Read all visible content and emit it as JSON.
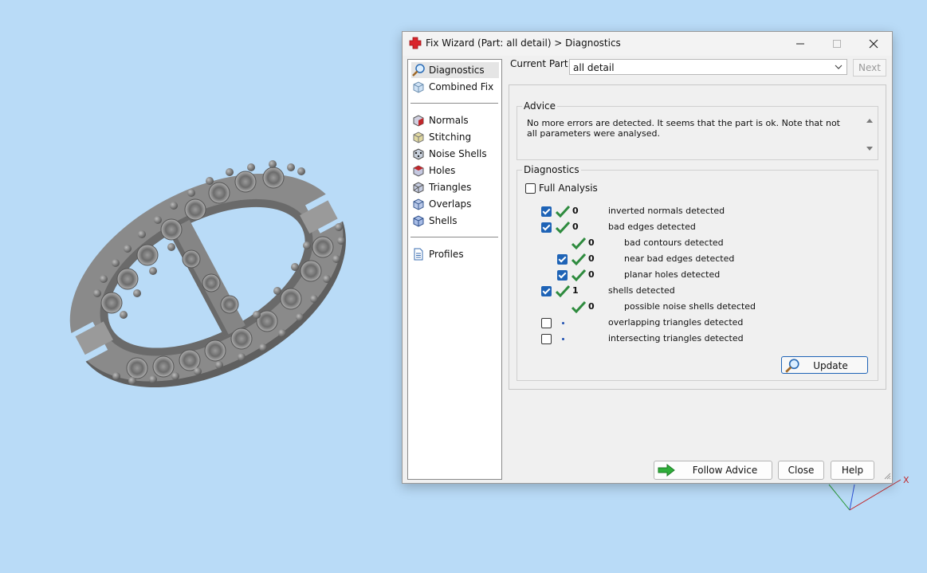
{
  "window": {
    "title": "Fix Wizard (Part: all detail) > Diagnostics"
  },
  "nav": {
    "items": [
      {
        "label": "Diagnostics",
        "icon": "magnifier-icon",
        "selected": true
      },
      {
        "label": "Combined Fix",
        "icon": "cube-icon"
      },
      {
        "label": "Normals",
        "icon": "normals-cube-icon"
      },
      {
        "label": "Stitching",
        "icon": "stitching-cube-icon"
      },
      {
        "label": "Noise Shells",
        "icon": "noise-shells-icon"
      },
      {
        "label": "Holes",
        "icon": "holes-cube-icon"
      },
      {
        "label": "Triangles",
        "icon": "triangles-cube-icon"
      },
      {
        "label": "Overlaps",
        "icon": "overlaps-cube-icon"
      },
      {
        "label": "Shells",
        "icon": "shells-cube-icon"
      },
      {
        "label": "Profiles",
        "icon": "profile-page-icon"
      }
    ]
  },
  "current_part": {
    "label": "Current Part:",
    "value": "all detail",
    "next_label": "Next"
  },
  "advice": {
    "title": "Advice",
    "text": "No more errors are detected. It seems that the part is ok. Note that not all parameters were analysed."
  },
  "diagnostics": {
    "title": "Diagnostics",
    "full_analysis_label": "Full Analysis",
    "full_analysis_checked": false,
    "rows": [
      {
        "checked": true,
        "status": "ok",
        "count": "0",
        "label": "inverted normals detected"
      },
      {
        "checked": true,
        "status": "ok",
        "count": "0",
        "label": "bad edges detected"
      },
      {
        "checkbox": false,
        "status": "ok",
        "count": "0",
        "label": "bad contours detected"
      },
      {
        "checked": true,
        "status": "ok",
        "count": "0",
        "label": "near bad edges detected"
      },
      {
        "checked": true,
        "status": "ok",
        "count": "0",
        "label": "planar holes detected"
      },
      {
        "checked": true,
        "status": "ok",
        "count": "1",
        "label": "shells detected"
      },
      {
        "checkbox": false,
        "status": "ok",
        "count": "0",
        "label": "possible noise shells detected"
      },
      {
        "checked": false,
        "status": "pending",
        "count": "",
        "label": "overlapping triangles detected"
      },
      {
        "checked": false,
        "status": "pending",
        "count": "",
        "label": "intersecting triangles detected"
      }
    ],
    "update_label": "Update"
  },
  "buttons": {
    "follow_advice": "Follow Advice",
    "close": "Close",
    "help": "Help"
  },
  "colors": {
    "background": "#b9dbf7",
    "check_green": "#2e8b3e",
    "accent_blue": "#1e63b6",
    "model_gray": "#808080"
  }
}
